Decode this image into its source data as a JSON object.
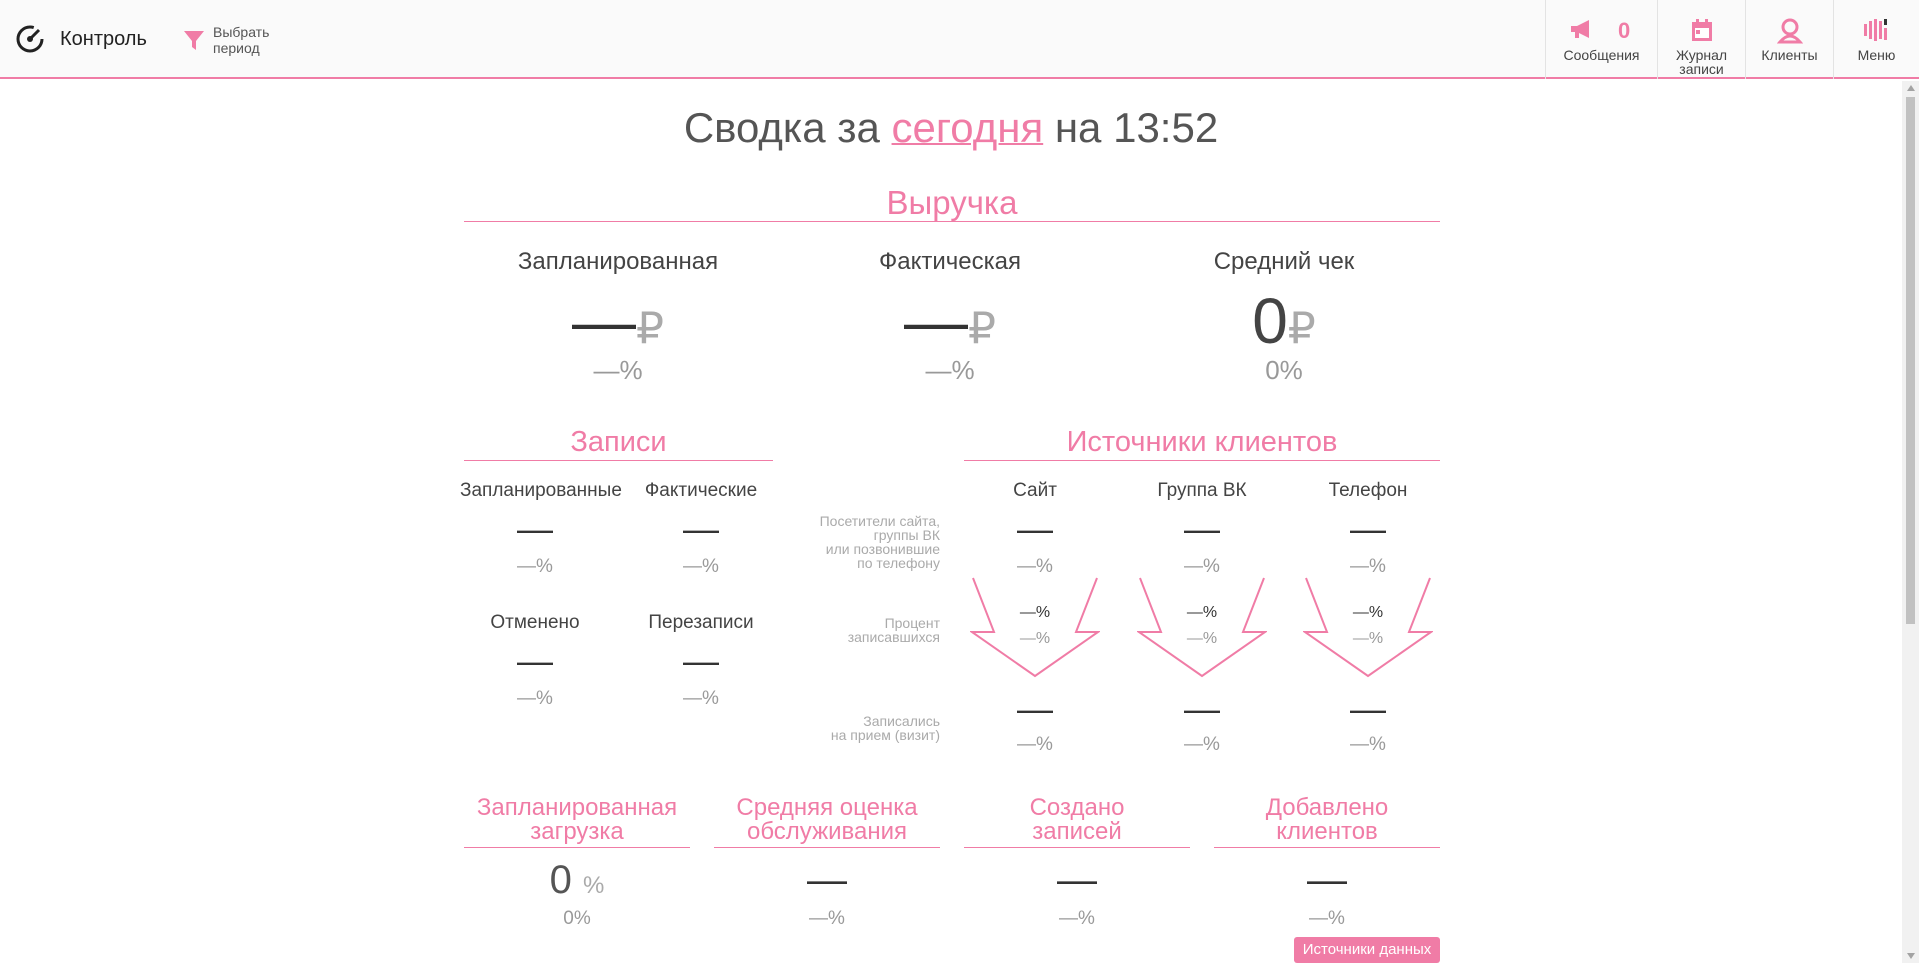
{
  "header": {
    "app_title": "Контроль",
    "period_button": "Выбрать\nпериод",
    "nav": [
      {
        "label": "Сообщения",
        "icon": "megaphone-icon",
        "count": "0"
      },
      {
        "label": "Журнал\nзаписи",
        "icon": "calendar-icon"
      },
      {
        "label": "Клиенты",
        "icon": "user-icon"
      },
      {
        "label": "Меню",
        "icon": "menu-icon"
      }
    ]
  },
  "headline": {
    "prefix": "Сводка за",
    "period": "сегодня",
    "suffix": "на 13:52"
  },
  "revenue": {
    "title": "Выручка",
    "cards": [
      {
        "label": "Запланированная",
        "value": "—",
        "currency": "₽",
        "pct": "—%"
      },
      {
        "label": "Фактическая",
        "value": "—",
        "currency": "₽",
        "pct": "—%"
      },
      {
        "label": "Средний чек",
        "value": "0",
        "currency": "₽",
        "pct": "0%"
      }
    ]
  },
  "records": {
    "title": "Записи",
    "cells": [
      {
        "label": "Запланированные",
        "value": "—",
        "pct": "—%"
      },
      {
        "label": "Фактические",
        "value": "—",
        "pct": "—%"
      },
      {
        "label": "Отменено",
        "value": "—",
        "pct": "—%"
      },
      {
        "label": "Перезаписи",
        "value": "—",
        "pct": "—%"
      }
    ]
  },
  "sources": {
    "title": "Источники клиентов",
    "notes": [
      "Посетители сайта,\nгруппы ВК\nили позвонившие\nпо телефону",
      "Процент\nзаписавшихся",
      "Записались\nна  прием (визит)"
    ],
    "columns": [
      {
        "label": "Сайт",
        "visitors": "—",
        "visitors_pct": "—%",
        "conv": "—%",
        "conv2": "—%",
        "booked": "—",
        "booked_pct": "—%"
      },
      {
        "label": "Группа ВК",
        "visitors": "—",
        "visitors_pct": "—%",
        "conv": "—%",
        "conv2": "—%",
        "booked": "—",
        "booked_pct": "—%"
      },
      {
        "label": "Телефон",
        "visitors": "—",
        "visitors_pct": "—%",
        "conv": "—%",
        "conv2": "—%",
        "booked": "—",
        "booked_pct": "—%"
      }
    ]
  },
  "bottom": [
    {
      "title": "Запланированная\nзагрузка",
      "value": "0",
      "unit": "%",
      "pct": "0%"
    },
    {
      "title": "Средняя оценка\nобслуживания",
      "value": "—",
      "unit": "",
      "pct": "—%"
    },
    {
      "title": "Создано\nзаписей",
      "value": "—",
      "unit": "",
      "pct": "—%"
    },
    {
      "title": "Добавлено\nклиентов",
      "value": "—",
      "unit": "",
      "pct": "—%"
    }
  ],
  "sources_button": "Источники данных",
  "colors": {
    "accent": "#f07ca6",
    "text": "#444444",
    "muted": "#999999"
  }
}
